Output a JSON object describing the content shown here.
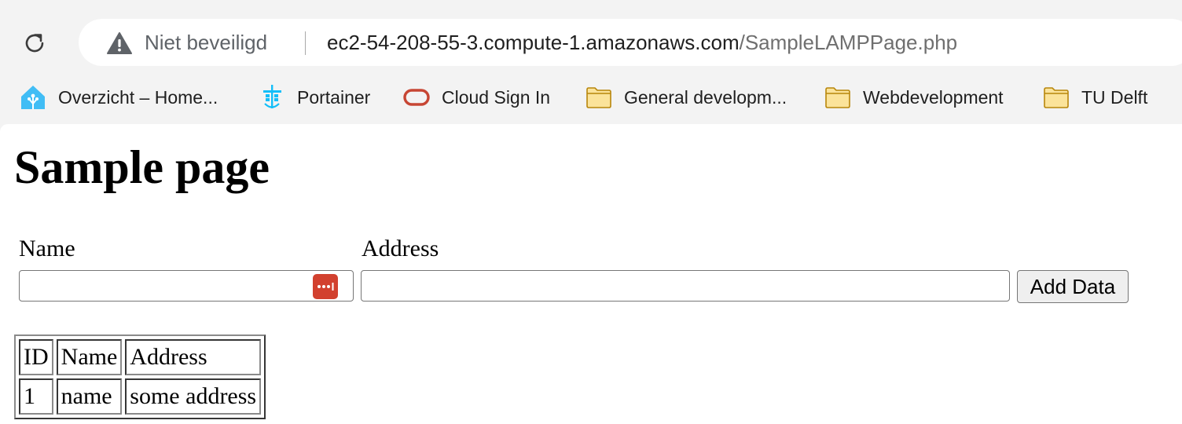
{
  "browser": {
    "security_label": "Niet beveiligd",
    "url_host": "ec2-54-208-55-3.compute-1.amazonaws.com",
    "url_path": "/SampleLAMPPage.php",
    "bookmarks": [
      {
        "label": "Overzicht – Home...",
        "icon": "home-assistant-icon",
        "color": "#41bdf5"
      },
      {
        "label": "Portainer",
        "icon": "portainer-icon",
        "color": "#13bef9"
      },
      {
        "label": "Cloud Sign In",
        "icon": "oracle-cloud-icon",
        "color": "#c74634"
      },
      {
        "label": "General developm...",
        "icon": "folder-icon",
        "color": "#fbe39a"
      },
      {
        "label": "Webdevelopment",
        "icon": "folder-icon",
        "color": "#fbe39a"
      },
      {
        "label": "TU Delft",
        "icon": "folder-icon",
        "color": "#fbe39a"
      }
    ]
  },
  "page": {
    "title": "Sample page",
    "form": {
      "name_label": "Name",
      "name_value": "",
      "address_label": "Address",
      "address_value": "",
      "submit_label": "Add Data"
    },
    "table": {
      "headers": [
        "ID",
        "Name",
        "Address"
      ],
      "rows": [
        [
          "1",
          "name",
          "some address"
        ]
      ]
    }
  }
}
